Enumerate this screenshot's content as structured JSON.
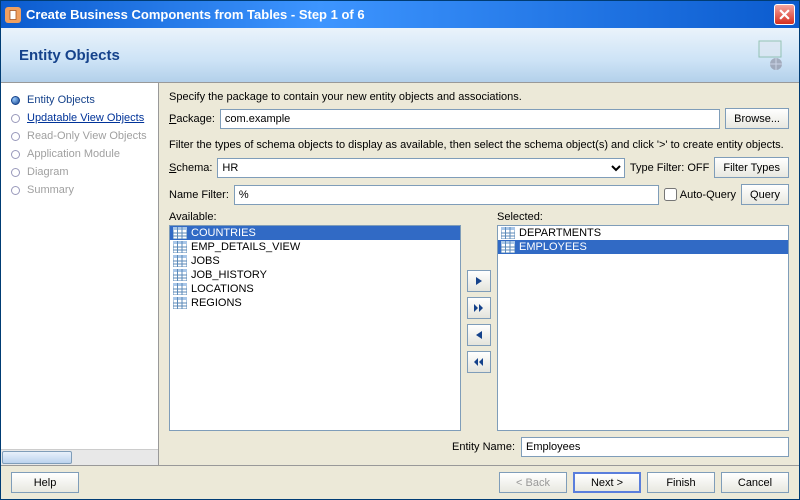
{
  "window": {
    "title": "Create Business Components from Tables - Step 1 of 6"
  },
  "header": {
    "title": "Entity Objects"
  },
  "steps": [
    {
      "label": "Entity Objects",
      "state": "active"
    },
    {
      "label": "Updatable View Objects",
      "state": "link"
    },
    {
      "label": "Read-Only View Objects",
      "state": "disabled"
    },
    {
      "label": "Application Module",
      "state": "disabled"
    },
    {
      "label": "Diagram",
      "state": "disabled"
    },
    {
      "label": "Summary",
      "state": "disabled"
    }
  ],
  "main": {
    "desc": "Specify the package to contain your new entity objects and associations.",
    "package_label": "Package:",
    "package_value": "com.example",
    "browse": "Browse...",
    "filter_desc": "Filter the types of schema objects to display as available, then select the schema object(s) and click '>' to create entity objects.",
    "schema_label": "Schema:",
    "schema_value": "HR",
    "type_filter_label": "Type Filter:",
    "type_filter_value": "OFF",
    "filter_types": "Filter Types",
    "name_filter_label": "Name Filter:",
    "name_filter_value": "%",
    "auto_query": "Auto-Query",
    "query": "Query",
    "available_label": "Available:",
    "selected_label": "Selected:",
    "available": [
      {
        "name": "COUNTRIES",
        "sel": true
      },
      {
        "name": "EMP_DETAILS_VIEW",
        "sel": false
      },
      {
        "name": "JOBS",
        "sel": false
      },
      {
        "name": "JOB_HISTORY",
        "sel": false
      },
      {
        "name": "LOCATIONS",
        "sel": false
      },
      {
        "name": "REGIONS",
        "sel": false
      }
    ],
    "selected": [
      {
        "name": "DEPARTMENTS",
        "sel": false
      },
      {
        "name": "EMPLOYEES",
        "sel": true
      }
    ],
    "entity_name_label": "Entity Name:",
    "entity_name_value": "Employees"
  },
  "footer": {
    "help": "Help",
    "back": "< Back",
    "next": "Next >",
    "finish": "Finish",
    "cancel": "Cancel"
  }
}
